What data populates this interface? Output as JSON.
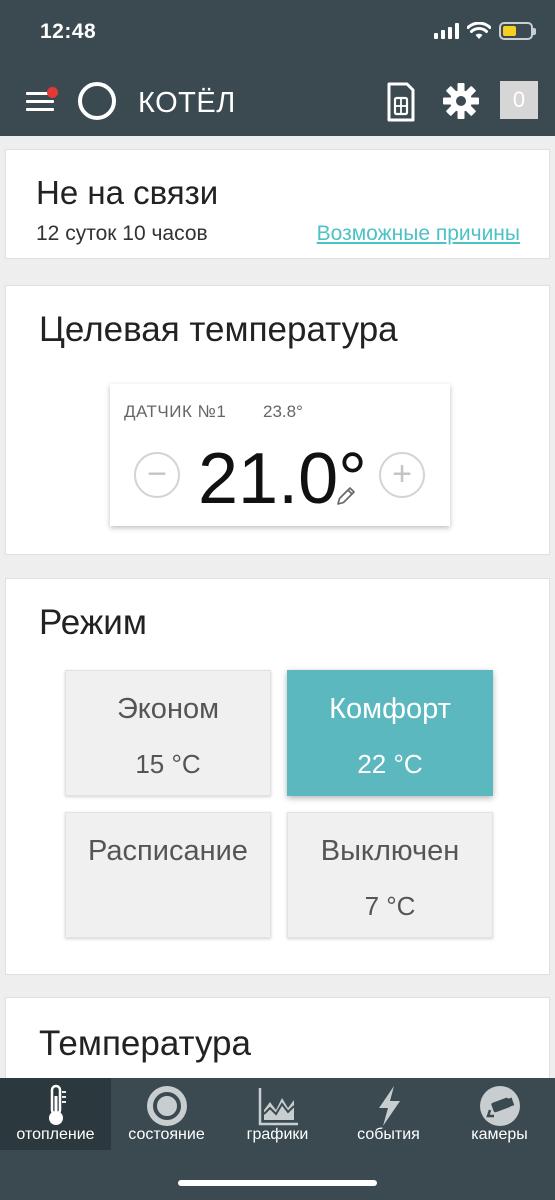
{
  "status_bar": {
    "time": "12:48",
    "icons": [
      "signal-icon",
      "wifi-icon",
      "battery-icon"
    ],
    "battery_level": 0.5
  },
  "header": {
    "title": "КОТЁЛ",
    "notification_count": "0",
    "icons": [
      "menu-icon",
      "ring-icon",
      "sim-card-icon",
      "gear-icon"
    ]
  },
  "connection": {
    "status": "Не на связи",
    "duration": "12 суток 10 часов",
    "reasons_link": "Возможные причины"
  },
  "target_temperature": {
    "heading": "Целевая температура",
    "sensor_name": "ДАТЧИК №1",
    "sensor_value": "23.8°",
    "value": "21.0°",
    "minus": "−",
    "plus": "+"
  },
  "mode": {
    "heading": "Режим",
    "options": [
      {
        "name": "Эконом",
        "temp": "15 °C",
        "active": false
      },
      {
        "name": "Комфорт",
        "temp": "22 °C",
        "active": true
      },
      {
        "name": "Расписание",
        "temp": "",
        "active": false
      },
      {
        "name": "Выключен",
        "temp": "7 °C",
        "active": false
      }
    ]
  },
  "temperature": {
    "heading": "Температура"
  },
  "bottom_nav": {
    "items": [
      {
        "label": "отопление",
        "icon": "thermometer-icon",
        "active": true
      },
      {
        "label": "состояние",
        "icon": "status-ring-icon",
        "active": false
      },
      {
        "label": "графики",
        "icon": "chart-icon",
        "active": false
      },
      {
        "label": "события",
        "icon": "lightning-icon",
        "active": false
      },
      {
        "label": "камеры",
        "icon": "camera-icon",
        "active": false
      }
    ]
  },
  "colors": {
    "header_bg": "#3a4a50",
    "accent": "#5cb8bf",
    "link": "#4cc2c6",
    "notification_dot": "#e53935"
  }
}
